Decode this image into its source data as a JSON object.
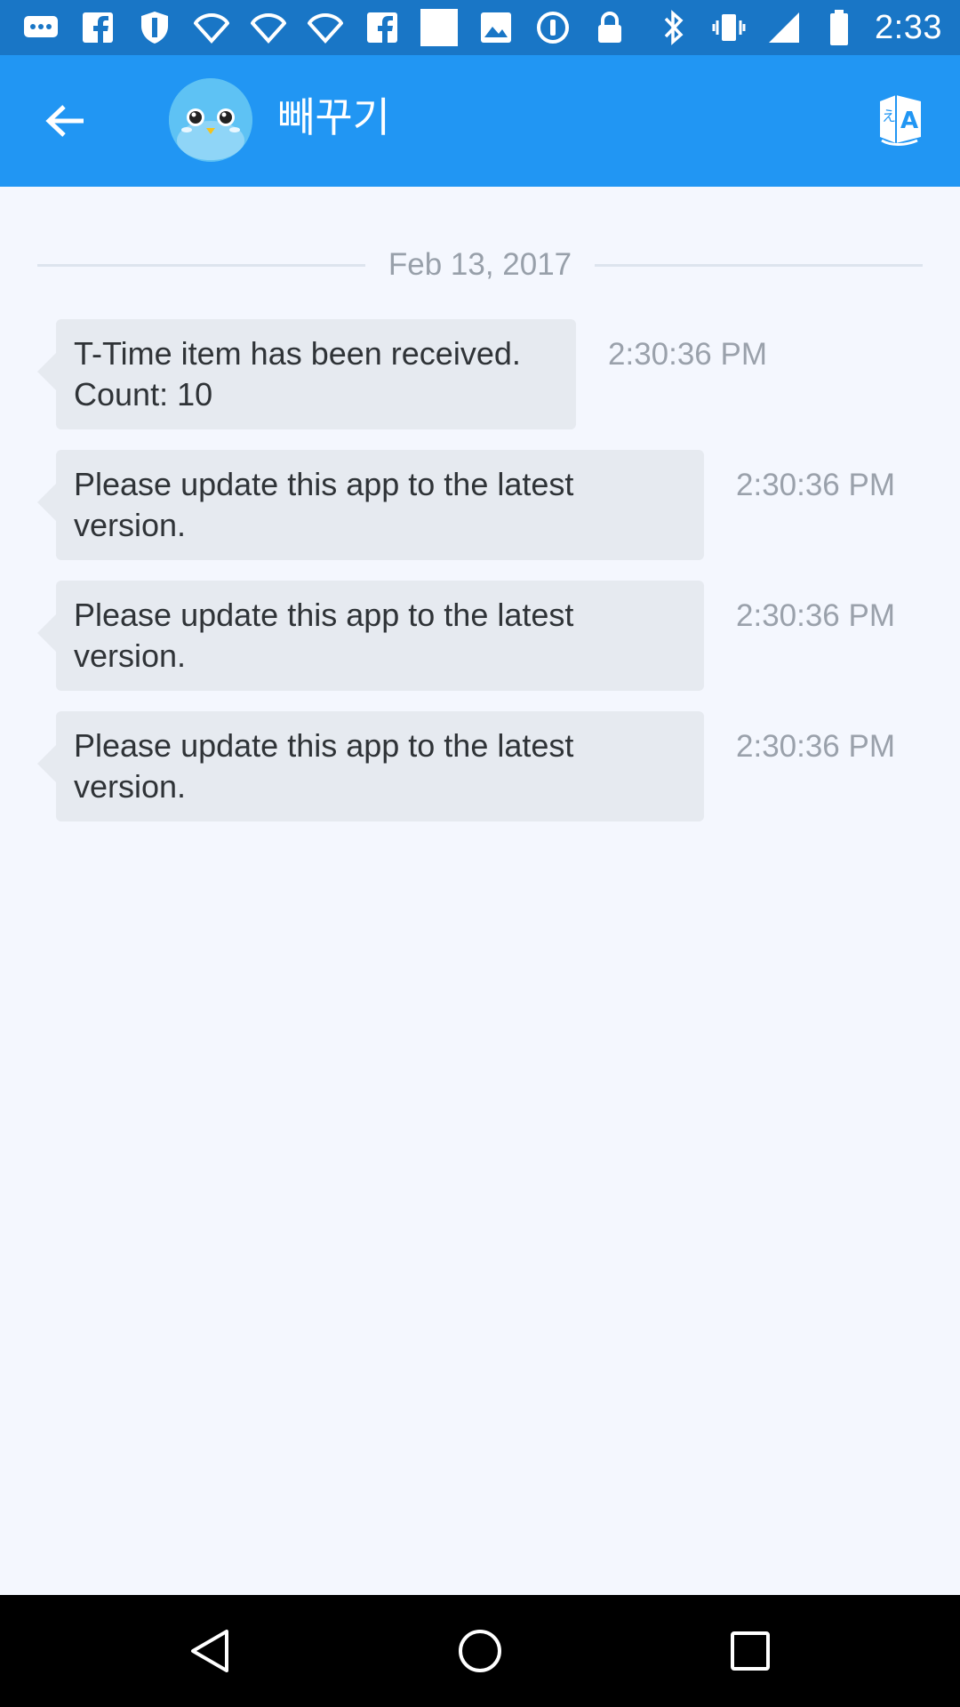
{
  "status_bar": {
    "time": "2:33",
    "left_icons": [
      "messages-icon",
      "facebook-icon",
      "shield-icon",
      "wifi-icon",
      "wifi-icon",
      "wifi-icon",
      "facebook-icon",
      "square-icon",
      "photo-icon",
      "circle-i-icon",
      "lock-icon"
    ],
    "right_icons": [
      "bluetooth-icon",
      "vibrate-icon",
      "signal-icon",
      "battery-icon"
    ]
  },
  "header": {
    "title": "빼꾸기",
    "bar_color": "#2196f3",
    "status_color": "#1976c6"
  },
  "chat": {
    "date": "Feb 13, 2017",
    "messages": [
      {
        "lines": [
          "T-Time item has been received.",
          "Count: 10"
        ],
        "time": "2:30:36 PM"
      },
      {
        "lines": [
          "Please update this app to the latest",
          "version."
        ],
        "time": "2:30:36 PM"
      },
      {
        "lines": [
          "Please update this app to the latest",
          "version."
        ],
        "time": "2:30:36 PM"
      },
      {
        "lines": [
          "Please update this app to the latest",
          "version."
        ],
        "time": "2:30:36 PM"
      }
    ]
  },
  "nav_bar": {
    "buttons": [
      "back-triangle-icon",
      "home-circle-icon",
      "recents-square-icon"
    ]
  }
}
